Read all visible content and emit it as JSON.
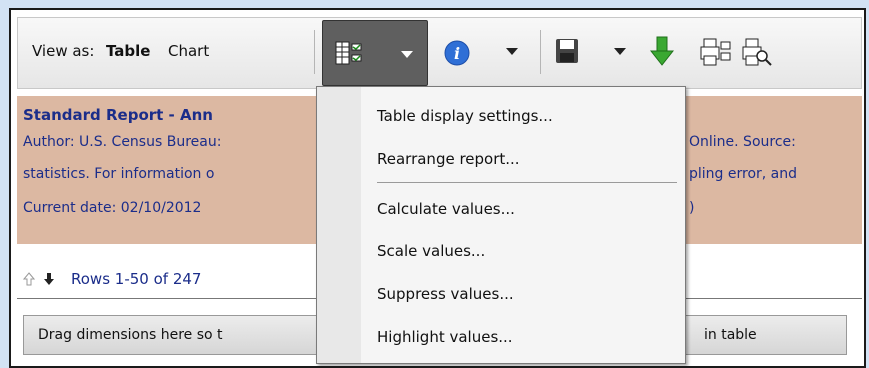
{
  "toolbar": {
    "view_as": "View as:",
    "table": "Table",
    "chart": "Chart"
  },
  "icons": {
    "table_settings": "table-settings-icon",
    "info": "info-icon",
    "save": "save-icon",
    "download": "download-icon",
    "print": "print-icon",
    "print_preview": "print-preview-icon"
  },
  "report": {
    "title": "Standard Report - Ann",
    "author_line_left": "Author: U.S. Census Bureau:",
    "author_line_right": "Online. Source:",
    "stats_line_left": "statistics. For information o",
    "stats_line_right": "pling error, and",
    "date_line_left": "Current date: 02/10/2012",
    "date_line_right": ")"
  },
  "rows": {
    "label": "Rows 1-50 of 247"
  },
  "drag": {
    "left": "Drag dimensions here so t",
    "right": "in table"
  },
  "menu": {
    "items": [
      "Table display settings...",
      "Rearrange report...",
      "Calculate values...",
      "Scale values...",
      "Suppress values...",
      "Highlight values..."
    ]
  },
  "colors": {
    "background": "#d2e2f4",
    "report_bg": "#dcb8a2",
    "link_blue": "#1b2d8a"
  }
}
